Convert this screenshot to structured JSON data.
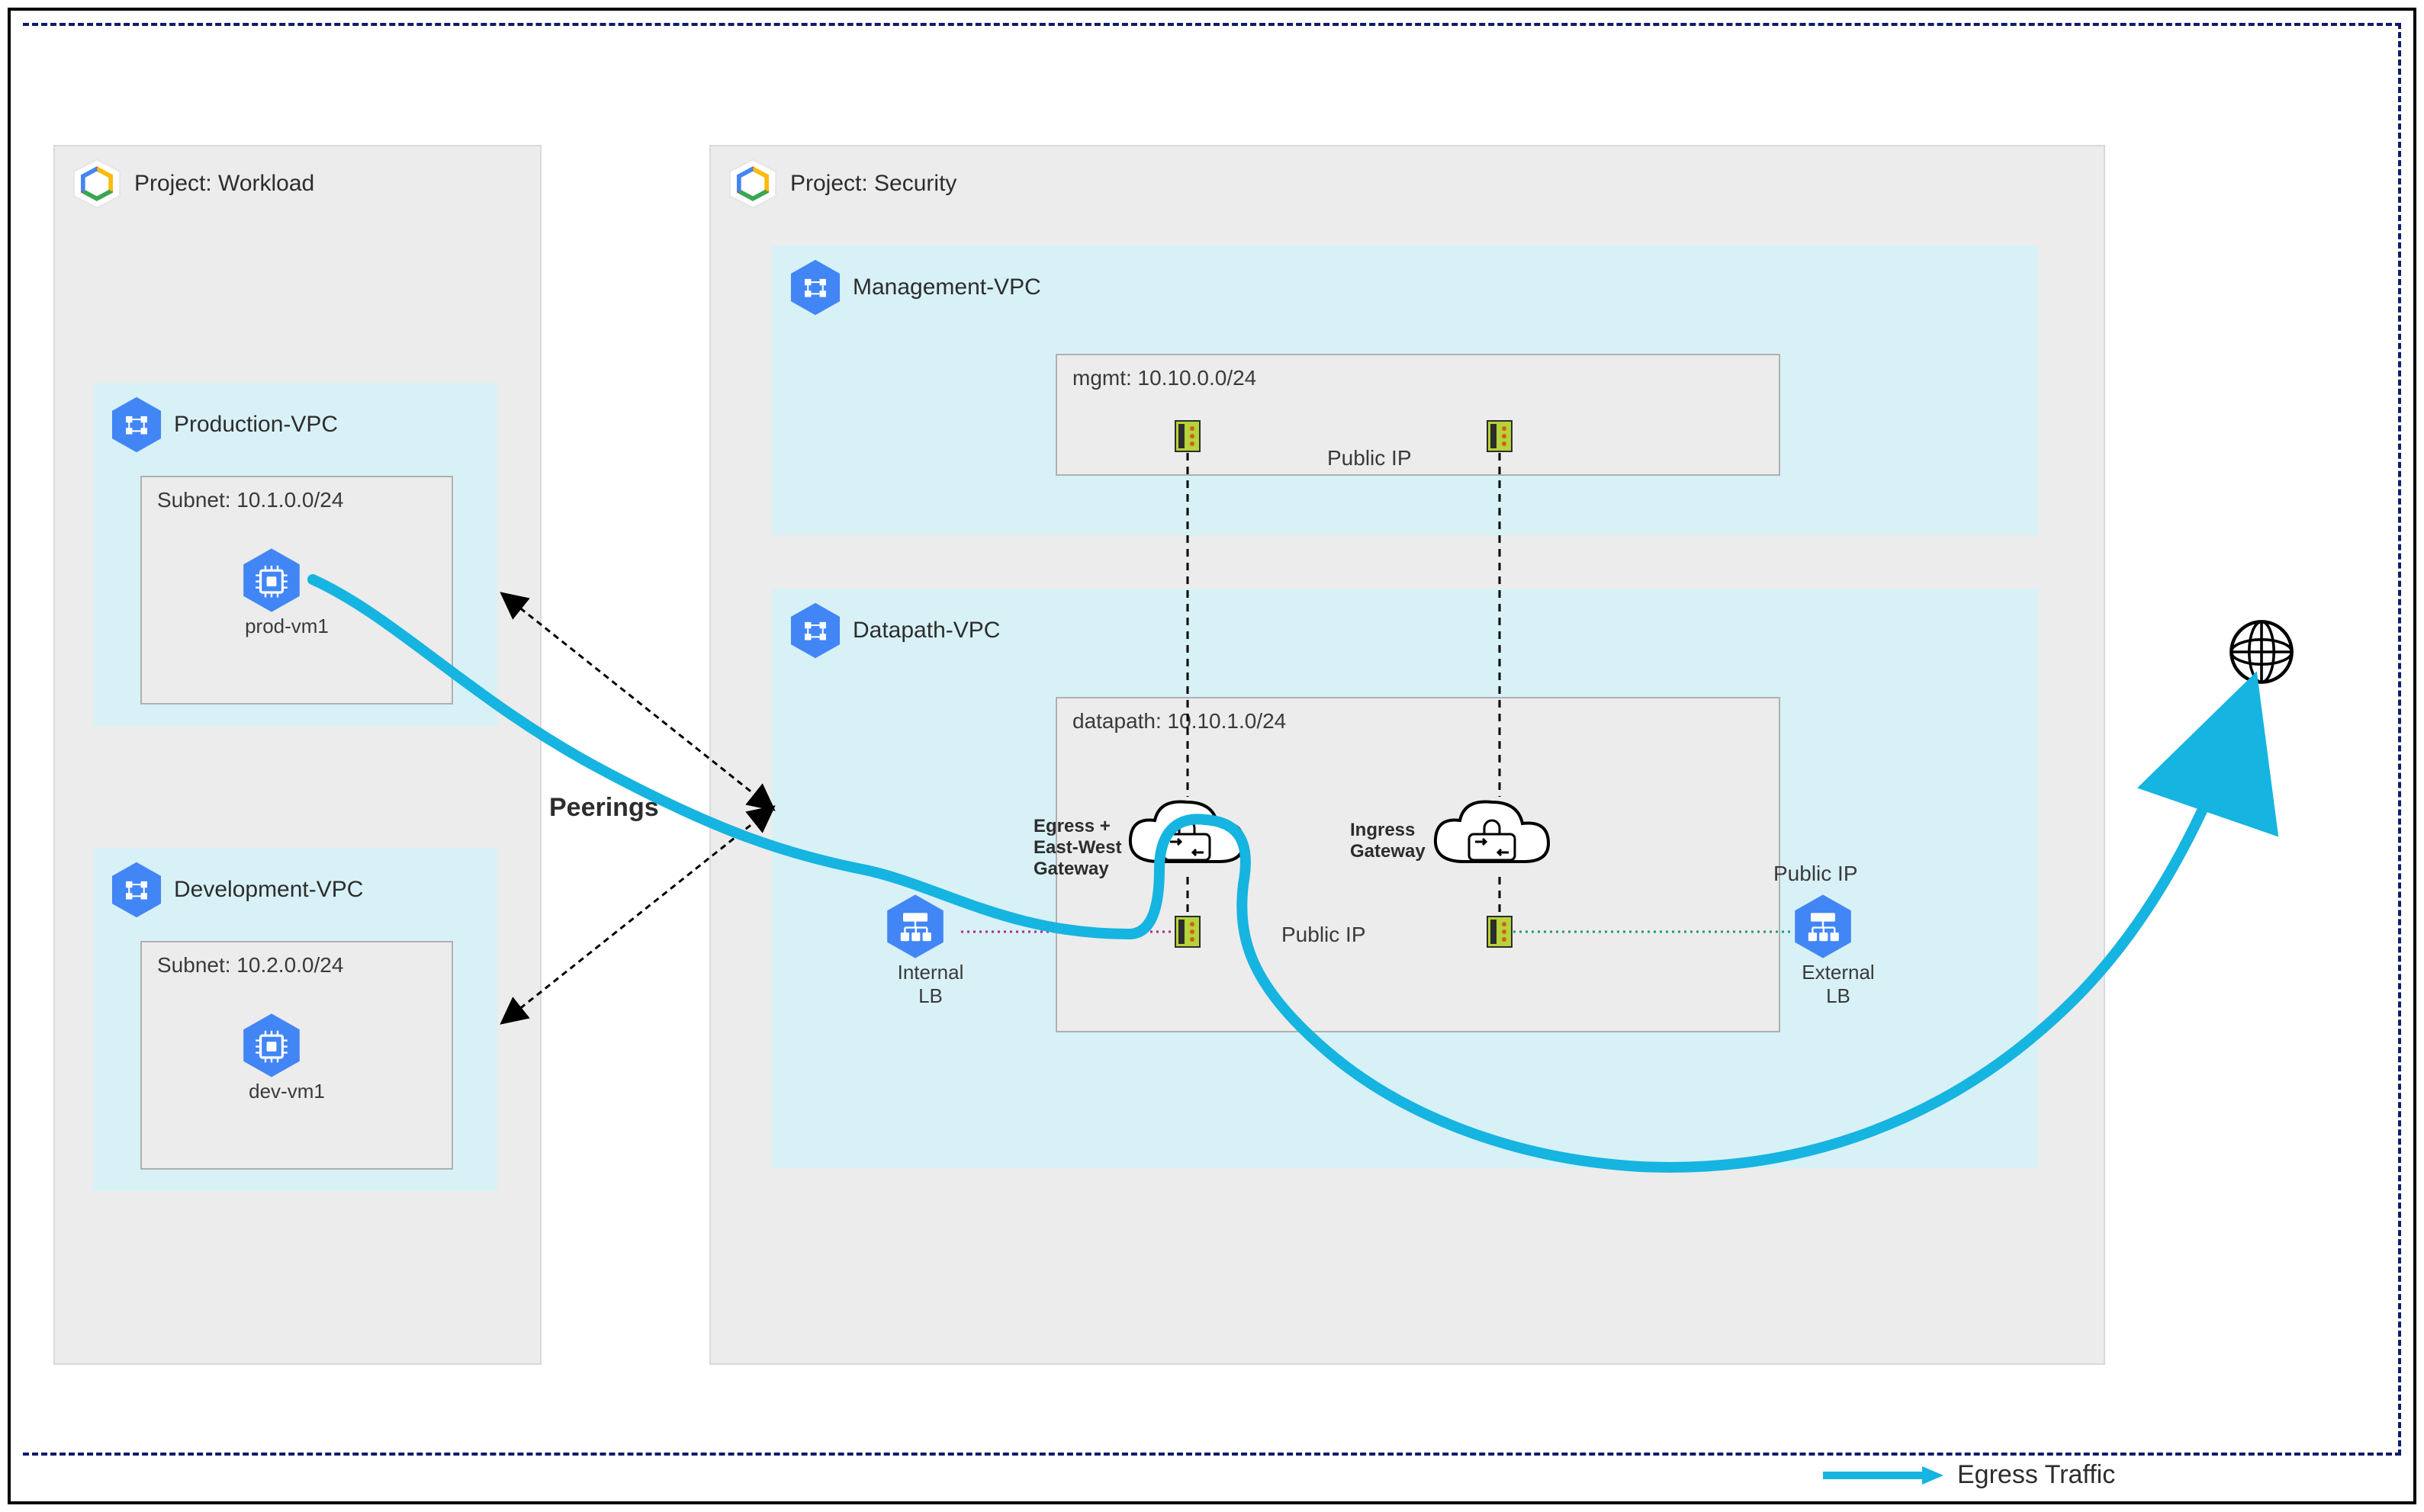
{
  "projects": {
    "workload": {
      "title": "Project:  Workload"
    },
    "security": {
      "title": "Project:  Security"
    }
  },
  "vpcs": {
    "production": {
      "title": "Production-VPC",
      "subnet": "Subnet:  10.1.0.0/24",
      "vm": "prod-vm1"
    },
    "development": {
      "title": "Development-VPC",
      "subnet": "Subnet:  10.2.0.0/24",
      "vm": "dev-vm1"
    },
    "management": {
      "title": "Management-VPC",
      "subnet": "mgmt: 10.10.0.0/24"
    },
    "datapath": {
      "title": "Datapath-VPC",
      "subnet": "datapath: 10.10.1.0/24"
    }
  },
  "gateways": {
    "egress": "Egress + East-West Gateway",
    "ingress": "Ingress Gateway"
  },
  "lbs": {
    "internal": "Internal LB",
    "external": "External LB"
  },
  "labels": {
    "peerings": "Peerings",
    "publicip": "Public IP",
    "egress_traffic": "Egress Traffic"
  }
}
